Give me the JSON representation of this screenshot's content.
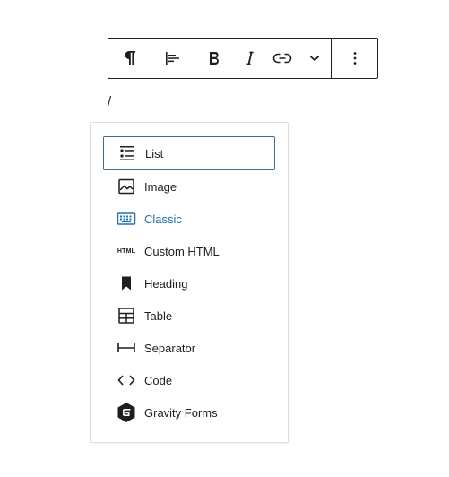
{
  "toolbar": {
    "buttons": [
      "paragraph-icon",
      "align-icon",
      "bold-icon",
      "italic-icon",
      "link-icon",
      "chevron-down-icon",
      "more-options-icon"
    ]
  },
  "editor": {
    "typed_text": "/"
  },
  "inserter": {
    "items": [
      {
        "label": "List",
        "icon": "list-icon",
        "state": "selected"
      },
      {
        "label": "Image",
        "icon": "image-icon"
      },
      {
        "label": "Classic",
        "icon": "keyboard-icon",
        "state": "highlight",
        "color": "#2271b1"
      },
      {
        "label": "Custom HTML",
        "icon": "html-icon",
        "icon_text": "HTML"
      },
      {
        "label": "Heading",
        "icon": "bookmark-icon"
      },
      {
        "label": "Table",
        "icon": "table-icon"
      },
      {
        "label": "Separator",
        "icon": "separator-icon"
      },
      {
        "label": "Code",
        "icon": "code-icon"
      },
      {
        "label": "Gravity Forms",
        "icon": "gravity-forms-icon"
      }
    ]
  }
}
